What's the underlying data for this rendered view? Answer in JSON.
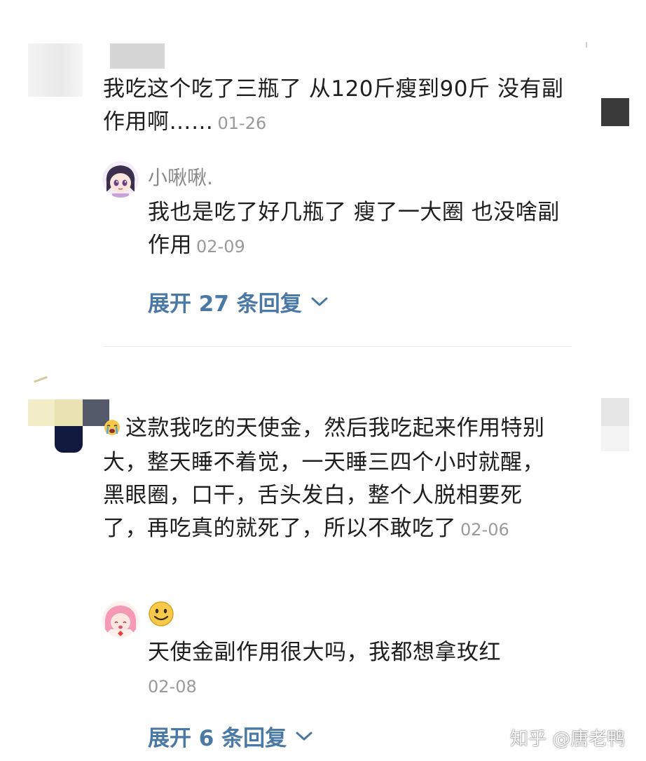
{
  "thread1": {
    "comment_text": "我吃这个吃了三瓶了 从120斤瘦到90斤 没有副作用啊……",
    "comment_time": "01-26",
    "reply_name": "小啾啾.",
    "reply_text": "我也是吃了好几瓶了 瘦了一大圈 也没啥副作用",
    "reply_time": "02-09",
    "expand_label": "展开 27 条回复"
  },
  "thread2": {
    "comment_text": "这款我吃的天使金，然后我吃起来作用特别大，整天睡不着觉，一天睡三四个小时就醒，黑眼圈，口干，舌头发白，整个人脱相要死了，再吃真的就死了，所以不敢吃了",
    "comment_time": "02-06",
    "reply_name_emoji": "🙂",
    "reply_text": "天使金副作用很大吗，我都想拿玫红",
    "reply_time": "02-08",
    "expand_label": "展开 6 条回复"
  },
  "watermark": "知乎 @唐老鸭",
  "colors": {
    "link": "#4a79a6",
    "timestamp": "#9a9a9a",
    "text": "#1e1e1e"
  },
  "icons": {
    "expand": "chevron-down-icon",
    "crying_emoji": "crying-emoji-icon",
    "smile_emoji": "smile-emoji-icon"
  }
}
